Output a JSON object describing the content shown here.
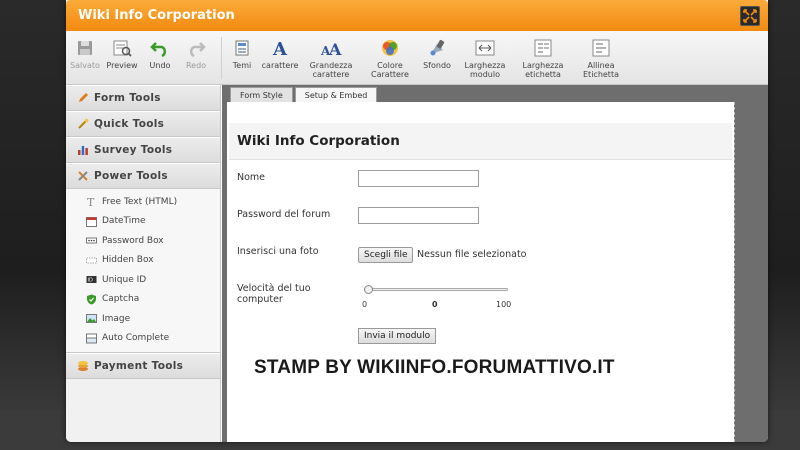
{
  "window": {
    "title": "Wiki Info Corporation"
  },
  "toolbar": {
    "items": [
      {
        "label": "Salvato",
        "icon": "save-icon",
        "disabled": true
      },
      {
        "label": "Preview",
        "icon": "preview-icon"
      },
      {
        "label": "Undo",
        "icon": "undo-icon"
      },
      {
        "label": "Redo",
        "icon": "redo-icon",
        "disabled": true
      },
      {
        "label": "Temi",
        "icon": "themes-icon"
      },
      {
        "label": "carattere",
        "icon": "font-icon"
      },
      {
        "label": "Grandezza carattere",
        "icon": "font-size-icon"
      },
      {
        "label": "Colore Carattere",
        "icon": "font-color-icon"
      },
      {
        "label": "Sfondo",
        "icon": "background-icon"
      },
      {
        "label": "Larghezza modulo",
        "icon": "form-width-icon"
      },
      {
        "label": "Larghezza etichetta",
        "icon": "label-width-icon"
      },
      {
        "label": "Allinea Etichetta",
        "icon": "align-label-icon"
      }
    ]
  },
  "sidebar": {
    "sections": {
      "form_tools": "Form Tools",
      "quick_tools": "Quick Tools",
      "survey_tools": "Survey Tools",
      "power_tools": "Power Tools",
      "payment_tools": "Payment Tools"
    },
    "power_items": [
      {
        "label": "Free Text (HTML)",
        "icon": "text-icon"
      },
      {
        "label": "DateTime",
        "icon": "calendar-icon"
      },
      {
        "label": "Password Box",
        "icon": "password-icon"
      },
      {
        "label": "Hidden Box",
        "icon": "hidden-box-icon"
      },
      {
        "label": "Unique ID",
        "icon": "unique-id-icon"
      },
      {
        "label": "Captcha",
        "icon": "captcha-shield-icon"
      },
      {
        "label": "Image",
        "icon": "image-icon"
      },
      {
        "label": "Auto Complete",
        "icon": "auto-complete-icon"
      }
    ]
  },
  "tabs": {
    "form_style": "Form Style",
    "setup_embed": "Setup & Embed"
  },
  "form": {
    "title": "Wiki Info Corporation",
    "fields": {
      "name_label": "Nome",
      "password_label": "Password del forum",
      "photo_label": "Inserisci una foto",
      "file_button": "Scegli file",
      "file_status": "Nessun file selezionato",
      "speed_label": "Velocità del tuo computer",
      "slider_min": "0",
      "slider_value": "0",
      "slider_max": "100",
      "slider_level": 0
    },
    "submit_label": "Invia il modulo"
  },
  "stamp": "STAMP BY WIKIINFO.FORUMATTIVO.IT",
  "colors": {
    "titlebar": "#f28a10",
    "sidebar": "#f1f1f1",
    "canvas": "#6e6e6e"
  }
}
